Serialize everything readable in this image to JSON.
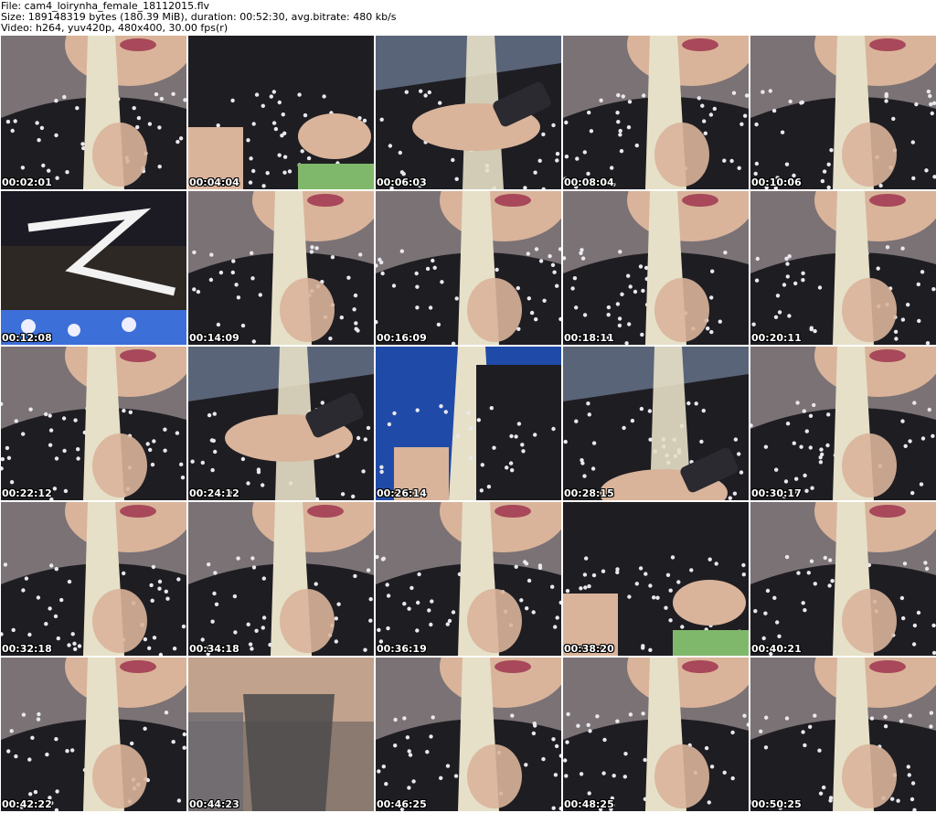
{
  "header": {
    "file_line": "File: cam4_loirynha_female_18112015.flv",
    "size_line": "Size: 189148319 bytes (180.39 MiB), duration: 00:52:30, avg.bitrate: 480 kb/s",
    "video_line": "Video: h264, yuv420p, 480x400, 30.00 fps(r)"
  },
  "thumbnails": [
    {
      "timestamp": "00:02:01",
      "scene": "lips-hair"
    },
    {
      "timestamp": "00:04:04",
      "scene": "torso-hand"
    },
    {
      "timestamp": "00:06:03",
      "scene": "phone-close"
    },
    {
      "timestamp": "00:08:04",
      "scene": "lips-hair"
    },
    {
      "timestamp": "00:10:06",
      "scene": "lips-hair"
    },
    {
      "timestamp": "00:12:08",
      "scene": "headboard"
    },
    {
      "timestamp": "00:14:09",
      "scene": "lips-hair"
    },
    {
      "timestamp": "00:16:09",
      "scene": "lips-hair"
    },
    {
      "timestamp": "00:18:11",
      "scene": "lips-hair"
    },
    {
      "timestamp": "00:20:11",
      "scene": "lips-hair"
    },
    {
      "timestamp": "00:22:12",
      "scene": "lips-hair"
    },
    {
      "timestamp": "00:24:12",
      "scene": "phone-close"
    },
    {
      "timestamp": "00:26:14",
      "scene": "blue-curtain"
    },
    {
      "timestamp": "00:28:15",
      "scene": "phone-low"
    },
    {
      "timestamp": "00:30:17",
      "scene": "lips-hair"
    },
    {
      "timestamp": "00:32:18",
      "scene": "lips-hair"
    },
    {
      "timestamp": "00:34:18",
      "scene": "lips-hair"
    },
    {
      "timestamp": "00:36:19",
      "scene": "lips-hair"
    },
    {
      "timestamp": "00:38:20",
      "scene": "torso-hand"
    },
    {
      "timestamp": "00:40:21",
      "scene": "lips-hair"
    },
    {
      "timestamp": "00:42:22",
      "scene": "lips-hair"
    },
    {
      "timestamp": "00:44:23",
      "scene": "blur"
    },
    {
      "timestamp": "00:46:25",
      "scene": "lips-hair"
    },
    {
      "timestamp": "00:48:25",
      "scene": "lips-hair"
    },
    {
      "timestamp": "00:50:25",
      "scene": "lips-hair"
    }
  ],
  "colors": {
    "skin": "#d9b49a",
    "skin_shadow": "#b98c70",
    "hair": "#e6e0c8",
    "dress": "#1e1d22",
    "dress_flower": "#e8e8ee",
    "lips": "#a8485a",
    "wall": "#5a6478",
    "curtain": "#1f4aa8",
    "phone": "#2a2a30",
    "headboard": "#2e2824"
  }
}
